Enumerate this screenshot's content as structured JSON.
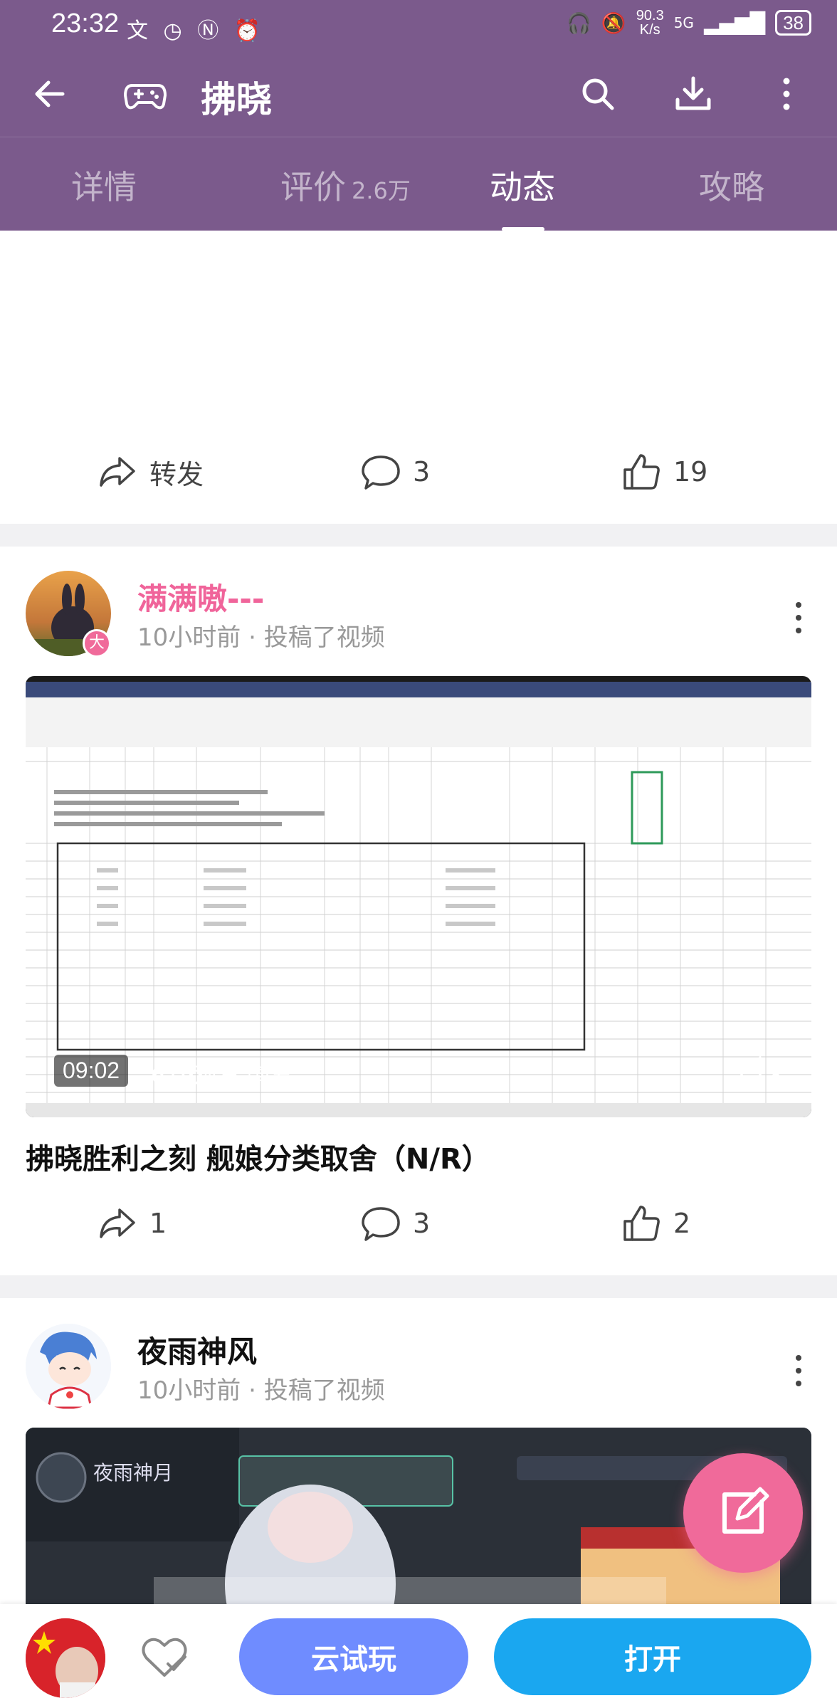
{
  "status_bar": {
    "time": "23:32",
    "net_speed_value": "90.3",
    "net_speed_unit": "K/s",
    "network": "5G",
    "battery": "38"
  },
  "app_bar": {
    "title": "拂晓",
    "icons": [
      "back-arrow-icon",
      "gamepad-icon",
      "search-icon",
      "download-icon",
      "more-vert-icon"
    ]
  },
  "tabs": [
    {
      "label": "详情",
      "count": ""
    },
    {
      "label": "评价",
      "count": "2.6万"
    },
    {
      "label": "动态",
      "count": "",
      "active": true
    },
    {
      "label": "攻略",
      "count": ""
    }
  ],
  "post0": {
    "share_label": "转发",
    "comments": "3",
    "likes": "19"
  },
  "post1": {
    "author": "满满嗷---",
    "badge": "大",
    "time": "10小时前",
    "action": "投稿了视频",
    "duration": "09:02",
    "views": "619观看",
    "danmaku": "弹幕",
    "title": "拂晓胜利之刻 舰娘分类取舍（N/R）",
    "shares": "1",
    "comments": "3",
    "likes": "2"
  },
  "post2": {
    "author": "夜雨神风",
    "time": "10小时前",
    "action": "投稿了视频",
    "thumb_text": "夜雨神月"
  },
  "bottom_bar": {
    "trial_label": "云试玩",
    "open_label": "打开"
  },
  "colors": {
    "header": "#7b5a8c",
    "author_pink": "#f0649a",
    "fab": "#f06a9a",
    "trial_button": "#6f8cff",
    "open_button": "#1aa7f0"
  }
}
